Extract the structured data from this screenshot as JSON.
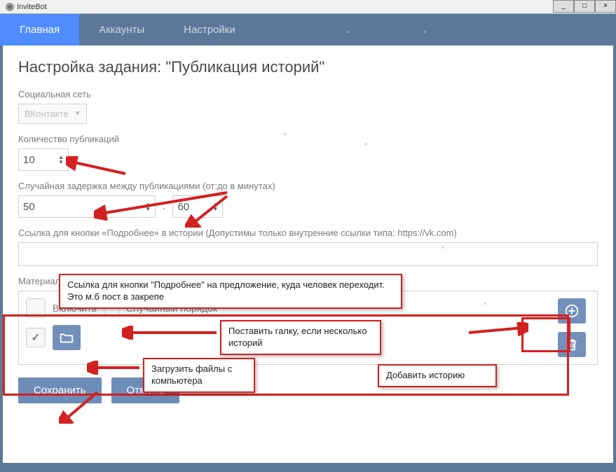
{
  "titlebar": {
    "app_name": "InviteBot"
  },
  "tabs": {
    "main": "Главная",
    "accounts": "Аккаунты",
    "settings": "Настройки"
  },
  "page_title": "Настройка задания: \"Публикация историй\"",
  "social": {
    "label": "Социальная сеть",
    "value": "ВКонтакте"
  },
  "count": {
    "label": "Количество публикаций",
    "value": "10"
  },
  "delay": {
    "label": "Случайная задержка между публикациями (от:до в минутах)",
    "from": "50",
    "to": "60"
  },
  "link": {
    "label": "Ссылка для кнопки «Подробнее» в истории (Допустимы только внутренние ссылки типа: https://vk.com)"
  },
  "materials": {
    "label": "Материалы для историй  (элементов: 1)",
    "enable": "Включить",
    "random": "Случайный порядок"
  },
  "buttons": {
    "save": "Сохранить",
    "cancel": "Отмена"
  },
  "annotations": {
    "link_note": "Ссылка для кнопки \"Подробнее\" на предложение, куда человек переходит. Это м.б пост в закрепе",
    "check_note": "Поставить галку, если несколько историй",
    "upload_note": "Загрузить файлы с компьютера",
    "add_note": "Добавить историю"
  }
}
